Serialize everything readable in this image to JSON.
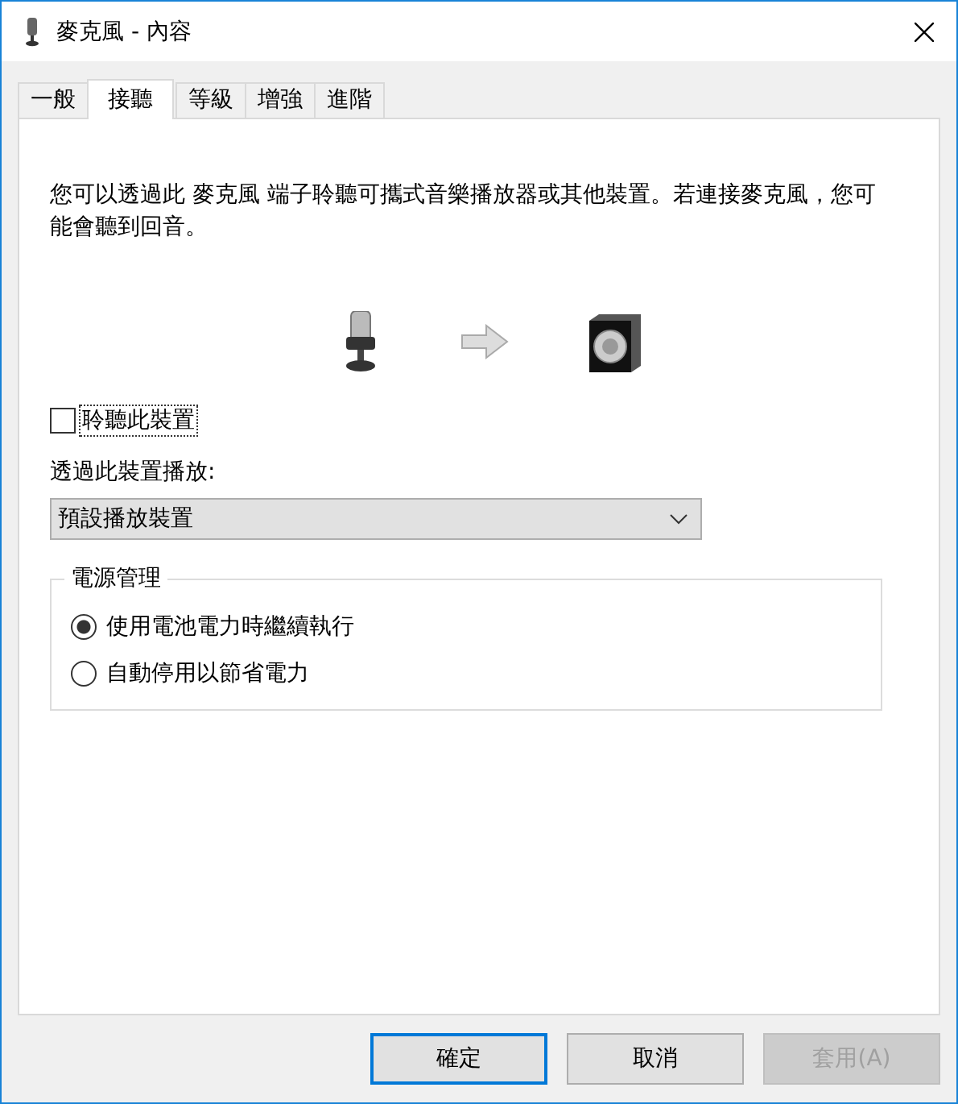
{
  "window": {
    "title": "麥克風 - 內容"
  },
  "tabs": [
    {
      "label": "一般",
      "selected": false
    },
    {
      "label": "接聽",
      "selected": true
    },
    {
      "label": "等級",
      "selected": false
    },
    {
      "label": "增強",
      "selected": false
    },
    {
      "label": "進階",
      "selected": false
    }
  ],
  "description": "您可以透過此 麥克風 端子聆聽可攜式音樂播放器或其他裝置。若連接麥克風，您可能會聽到回音。",
  "listen_checkbox": {
    "label": "聆聽此裝置",
    "checked": false
  },
  "playback_label": "透過此裝置播放:",
  "playback_dropdown": {
    "value": "預設播放裝置"
  },
  "power_group": {
    "title": "電源管理",
    "options": [
      {
        "label": "使用電池電力時繼續執行",
        "selected": true
      },
      {
        "label": "自動停用以節省電力",
        "selected": false
      }
    ]
  },
  "buttons": [
    {
      "label": "確定",
      "default": true,
      "disabled": false
    },
    {
      "label": "取消",
      "default": false,
      "disabled": false
    },
    {
      "label": "套用(A)",
      "default": false,
      "disabled": true
    }
  ]
}
